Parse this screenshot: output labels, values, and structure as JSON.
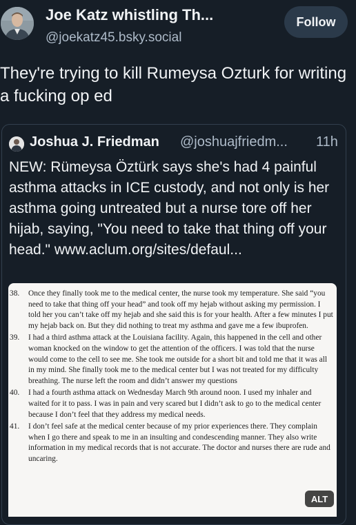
{
  "post": {
    "author": {
      "display_name": "Joe Katz whistling Th...",
      "handle": "@joekatz45.bsky.social",
      "avatar_icon": "user-avatar"
    },
    "follow_label": "Follow",
    "text": "They're trying to kill Rumeysa Ozturk for writing a fucking op ed"
  },
  "quote": {
    "author": {
      "display_name": "Joshua J. Friedman",
      "handle": "@joshuajfriedm...",
      "avatar_icon": "user-avatar"
    },
    "time": "11h",
    "text": "NEW: Rümeysa Öztürk says she's had 4 painful asthma attacks in ICE custody, and not only is her asthma going untreated but a nurse tore off her hijab, saying, \"You need to take that thing off your head.\" www.aclum.org/sites/defaul...",
    "image": {
      "alt_badge": "ALT",
      "paragraphs": [
        {
          "number": "38.",
          "text": "Once they finally took me to the medical center, the nurse took my temperature. She said “you need to take that thing off your head” and took off my hejab without asking my permission. I told her you can’t take off my hejab and she said this is for your health. After a few minutes I put my hejab back on. But they did nothing to treat my asthma and gave me a few ibuprofen."
        },
        {
          "number": "39.",
          "text": "I had a third asthma attack at the Louisiana facility. Again, this happened in the cell and other woman knocked on the window to get the attention of the officers. I was told that the nurse would come to the cell to see me. She took me outside for a short bit and told me that it was all in my mind. She finally took me to the medical center but I was not treated for my difficulty breathing. The nurse left the room and didn’t answer my questions"
        },
        {
          "number": "40.",
          "text": "I had a fourth asthma attack on Wednesday March 9th around noon. I used my inhaler and waited for it to pass. I was in pain and very scared but I didn’t ask to go to the medical center because I don’t feel that they address my medical needs."
        },
        {
          "number": "41.",
          "text": "I don’t feel safe at the medical center because of my prior experiences there. They complain when I go there and speak to me in an insulting and condescending manner. They also write information in my medical records that is not accurate. The doctor and nurses there are rude and uncaring."
        }
      ]
    }
  },
  "colors": {
    "background": "#161e27",
    "text_primary": "#f1f3f5",
    "text_secondary": "#aebbc9",
    "follow_button_bg": "#2b3a4a",
    "card_border": "#33404e",
    "document_bg": "#f7f6f4"
  }
}
